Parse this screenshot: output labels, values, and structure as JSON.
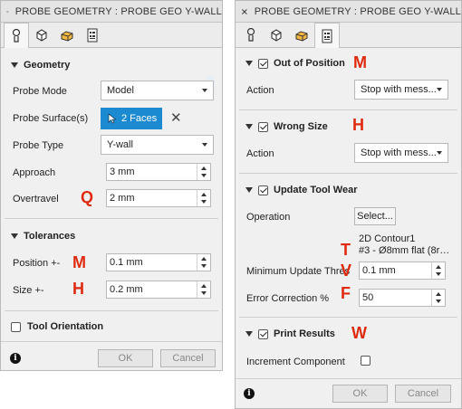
{
  "left": {
    "title": "PROBE GEOMETRY : PROBE GEO Y-WALL",
    "tabs": [
      "tool-tab",
      "geometry-tab",
      "heights-tab",
      "actions-tab"
    ],
    "geometry_group": "Geometry",
    "probe_mode_label": "Probe Mode",
    "probe_mode_value": "Model",
    "probe_surface_label": "Probe Surface(s)",
    "probe_surface_value": "2 Faces",
    "probe_type_label": "Probe Type",
    "probe_type_value": "Y-wall",
    "approach_label": "Approach",
    "approach_value": "3 mm",
    "overtravel_label": "Overtravel",
    "overtravel_value": "2 mm",
    "tolerances_group": "Tolerances",
    "position_label": "Position +-",
    "position_value": "0.1 mm",
    "size_label": "Size +-",
    "size_value": "0.2 mm",
    "tool_orientation_label": "Tool Orientation",
    "ok_label": "OK",
    "cancel_label": "Cancel",
    "annotations": {
      "overtravel": "Q",
      "position": "M",
      "size": "H"
    }
  },
  "right": {
    "title": "PROBE GEOMETRY : PROBE GEO Y-WALL",
    "out_of_position_label": "Out of Position",
    "out_of_position_action_label": "Action",
    "out_of_position_action_value": "Stop with mess...",
    "wrong_size_label": "Wrong Size",
    "wrong_size_action_label": "Action",
    "wrong_size_action_value": "Stop with mess...",
    "update_tool_wear_label": "Update Tool Wear",
    "operation_label": "Operation",
    "operation_value": "Select...",
    "operation_line1": "2D Contour1",
    "operation_line2": "#3 - Ø8mm flat (8r…",
    "min_update_label": "Minimum Update Thres",
    "min_update_value": "0.1 mm",
    "error_correction_label": "Error Correction %",
    "error_correction_value": "50",
    "print_results_label": "Print Results",
    "increment_component_label": "Increment Component",
    "ok_label": "OK",
    "cancel_label": "Cancel",
    "annotations": {
      "out_of_position": "M",
      "wrong_size": "H",
      "min_update_t": "T",
      "min_update_v": "V",
      "error_correction": "F",
      "print_results": "W"
    }
  },
  "colors": {
    "accent": "#1c8ad0",
    "annotation": "#e02a10",
    "panel": "#f0f0f0"
  }
}
